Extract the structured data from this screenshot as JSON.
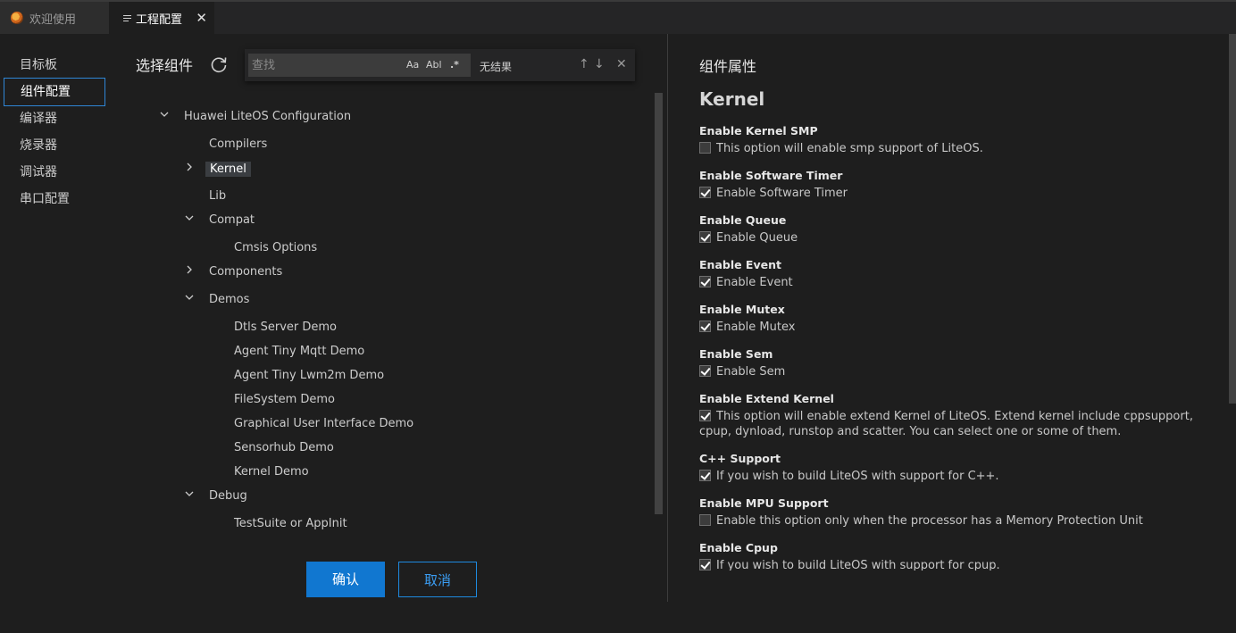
{
  "tabs": [
    {
      "label": "欢迎使用"
    },
    {
      "label": "工程配置",
      "close": "✕"
    }
  ],
  "nav": {
    "items": [
      {
        "label": "目标板"
      },
      {
        "label": "组件配置"
      },
      {
        "label": "编译器"
      },
      {
        "label": "烧录器"
      },
      {
        "label": "调试器"
      },
      {
        "label": "串口配置"
      }
    ],
    "active_index": 1
  },
  "select_panel": {
    "title": "选择组件",
    "find": {
      "placeholder": "查找",
      "match_case": "Aa",
      "whole_word": "Abl",
      "regex": ".*",
      "result": "无结果",
      "prev": "↑",
      "next": "↓",
      "close": "✕"
    },
    "tree": {
      "root": "Huawei LiteOS Configuration",
      "compilers": "Compilers",
      "kernel": "Kernel",
      "lib": "Lib",
      "compat": "Compat",
      "cmsis": "Cmsis Options",
      "components": "Components",
      "demos": "Demos",
      "demo_items": [
        "Dtls Server Demo",
        "Agent Tiny Mqtt Demo",
        "Agent Tiny Lwm2m Demo",
        "FileSystem Demo",
        "Graphical User Interface Demo",
        "Sensorhub Demo",
        "Kernel Demo"
      ],
      "debug": "Debug",
      "testsuite": "TestSuite or AppInit"
    },
    "confirm": "确认",
    "cancel": "取消"
  },
  "properties": {
    "title": "组件属性",
    "component": "Kernel",
    "items": [
      {
        "label": "Enable Kernel SMP",
        "checked": false,
        "desc": "This option will enable smp support of LiteOS."
      },
      {
        "label": "Enable Software Timer",
        "checked": true,
        "desc": "Enable Software Timer"
      },
      {
        "label": "Enable Queue",
        "checked": true,
        "desc": "Enable Queue"
      },
      {
        "label": "Enable Event",
        "checked": true,
        "desc": "Enable Event"
      },
      {
        "label": "Enable Mutex",
        "checked": true,
        "desc": "Enable Mutex"
      },
      {
        "label": "Enable Sem",
        "checked": true,
        "desc": "Enable Sem"
      },
      {
        "label": "Enable Extend Kernel",
        "checked": true,
        "desc": "This option will enable extend Kernel of LiteOS. Extend kernel include cppsupport, cpup, dynload, runstop and scatter. You can select one or some of them."
      },
      {
        "label": "C++ Support",
        "checked": true,
        "desc": "If you wish to build LiteOS with support for C++."
      },
      {
        "label": "Enable MPU Support",
        "checked": false,
        "desc": "Enable this option only when the processor has a Memory Protection Unit"
      },
      {
        "label": "Enable Cpup",
        "checked": true,
        "desc": "If you wish to build LiteOS with support for cpup."
      }
    ]
  }
}
